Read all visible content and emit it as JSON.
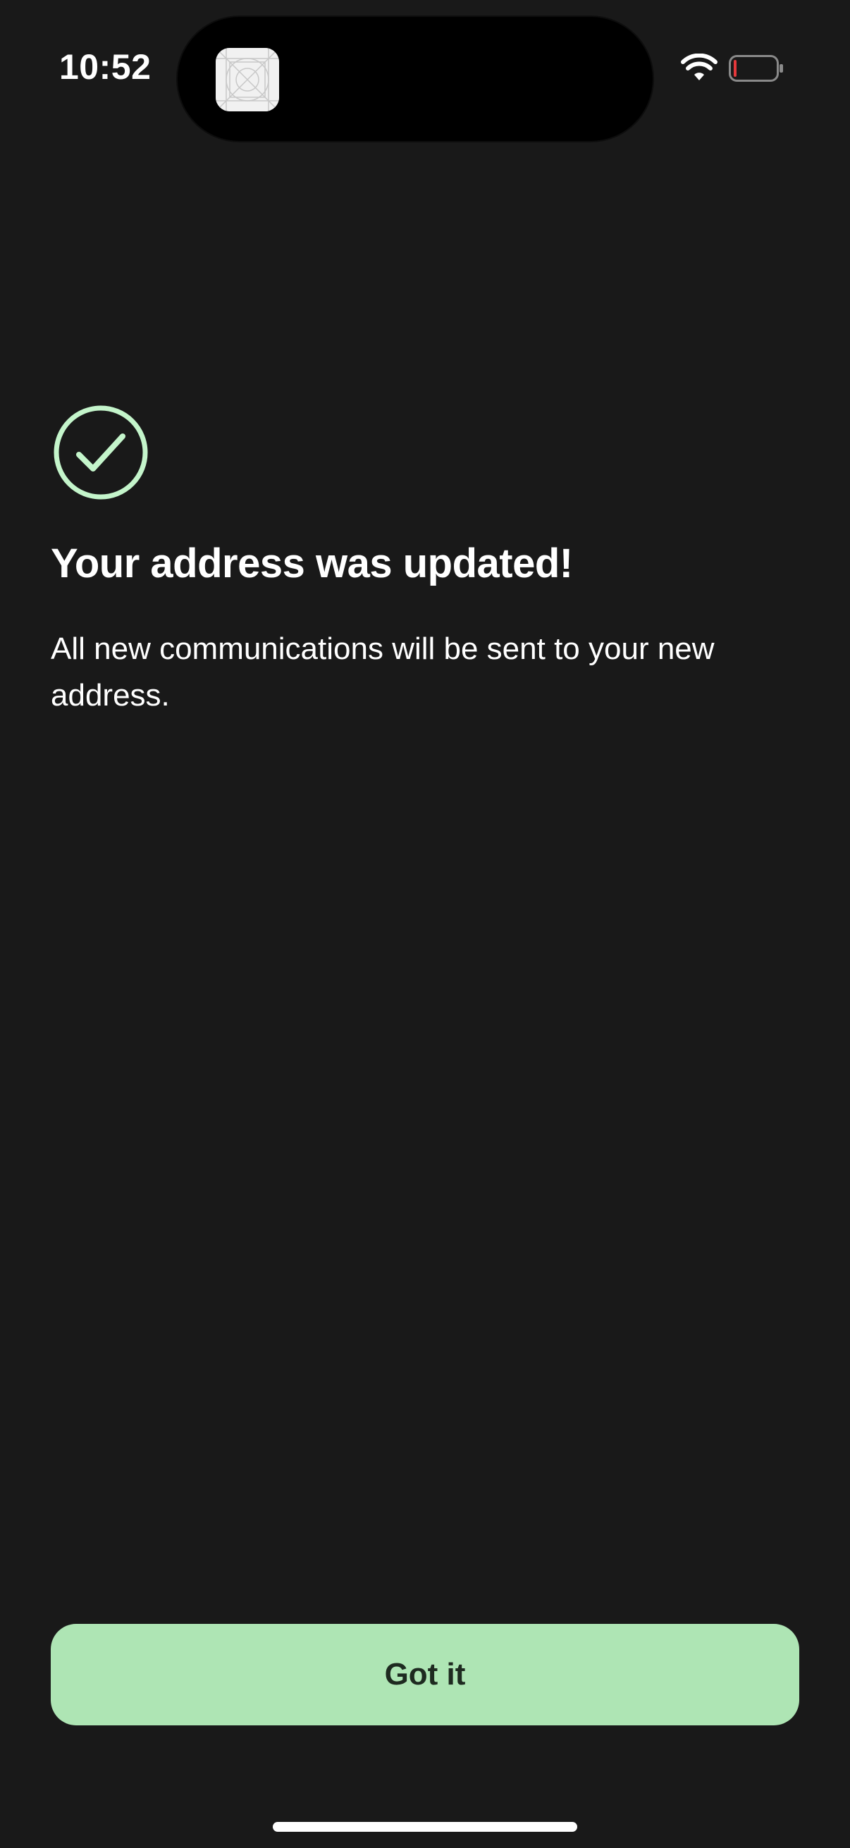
{
  "status_bar": {
    "time": "10:52",
    "icons": {
      "wifi": "wifi-icon",
      "battery": "battery-icon",
      "island_app": "app-placeholder-icon"
    },
    "battery_level_percent": 5,
    "battery_low_color": "#e5383b"
  },
  "confirmation": {
    "icon": "check-circle-icon",
    "title": "Your address was updated!",
    "message": "All new communications will be sent to your new address."
  },
  "actions": {
    "got_it_label": "Got it"
  },
  "colors": {
    "background": "#191919",
    "accent": "#aee5b4",
    "check_icon": "#c4f5cb",
    "text": "#ffffff",
    "button_text": "#1e2a20"
  }
}
